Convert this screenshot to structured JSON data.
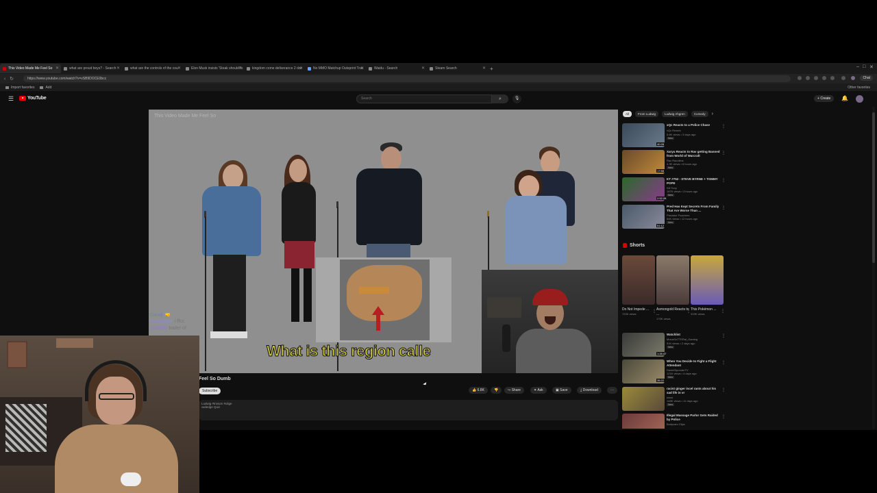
{
  "browser": {
    "tabs": [
      {
        "label": "This Video Made Me Feel So",
        "active": true,
        "favicon": "youtube"
      },
      {
        "label": "what are proud boys? - Search",
        "active": false,
        "favicon": "bing"
      },
      {
        "label": "what are the controls of the cou",
        "active": false,
        "favicon": "bing"
      },
      {
        "label": "Elon Musk insists 'Steak should fo",
        "active": false,
        "favicon": "news"
      },
      {
        "label": "kingdom come deliverance 2 dwr",
        "active": false,
        "favicon": "bing"
      },
      {
        "label": "No MMO Matchup Outsprint Trac",
        "active": false,
        "favicon": "github"
      },
      {
        "label": "Waidu - Search",
        "active": false,
        "favicon": "bing"
      },
      {
        "label": "Steam Search",
        "active": false,
        "favicon": "steam"
      }
    ],
    "new_tab": "+",
    "window_controls": [
      "–",
      "□",
      "✕"
    ],
    "url": "https://www.youtube.com/watch?v=vSB9DOCE0bcc",
    "chat_button": "Chat",
    "bookmarks": [
      "Import favorites",
      "Add"
    ],
    "other_favorites": "Other favorites"
  },
  "youtube": {
    "logo_text": "YouTube",
    "search_placeholder": "Search",
    "create_label": "Create"
  },
  "player": {
    "overlay_title": "This Video Made Me Feel So",
    "caption": "What is this region calle",
    "chat": [
      {
        "user": "Gandj",
        "msg": "🤜"
      },
      {
        "user": "wheburger",
        "msg": "i ffcc"
      },
      {
        "user": "cyton88",
        "msg": "trailer of"
      }
    ]
  },
  "video": {
    "title": "Feel So Dumb",
    "subscribe": "Subscribe",
    "actions": {
      "likes": "6.8K",
      "share": "Share",
      "ask": "Ask",
      "save": "Save",
      "download": "Download",
      "more": "···"
    },
    "description_line1": "Ludwig #trivium #ulige",
    "description_line2": "owledge Quiz"
  },
  "sidebar": {
    "chips": [
      "All",
      "From Ludwig",
      "Ludwig Ahgren",
      "Comedy"
    ],
    "recommendations": [
      {
        "title": "xQc Reacts to a Police Chase",
        "channel": "xQc Reacts",
        "meta": "5.6K views • 3 days ago",
        "badge": "New",
        "duration": "40:28"
      },
      {
        "title": "Xaryu Reacts to Rav getting Banned from World of Warcraft",
        "channel": "Rav Racolitos",
        "meta": "4.3K views • 6 hours ago",
        "badge": "New",
        "duration": "17:58"
      },
      {
        "title": "KT #752 - STEVE BYRNE + TOMMY POPE",
        "channel": "Kill Tony",
        "meta": "187K views • 3 hours ago",
        "badge": "New",
        "duration": "2:52:26"
      },
      {
        "title": "Pred Has Kept Secrets From Family That Are Worse Than ...",
        "channel": "Predator Poachers",
        "meta": "54K views • 12 hours ago",
        "badge": "New",
        "duration": "51:12"
      },
      {
        "title": "Watchlist",
        "channel": "MonoGoTTERal_Gaming",
        "meta": "51K views • 2 days ago",
        "badge": "New",
        "duration": "1:26:47"
      },
      {
        "title": "When You Decide to Fight a Flight Attendant",
        "channel": "DanielSponderTV",
        "meta": "121K views • 4 days ago",
        "badge": "New",
        "duration": "35:22"
      },
      {
        "title": "racist ginger incel rants about his sad life in vr",
        "channel": "wwst",
        "meta": "148K views • 11 days ago",
        "badge": "New",
        "duration": ""
      },
      {
        "title": "Illegal Massage Parlor Gets Raided by Police",
        "channel": "Bodycam Clips",
        "meta": "",
        "badge": "",
        "duration": ""
      }
    ],
    "shorts_title": "Shorts",
    "shorts": [
      {
        "label": "Do Not Impede ...",
        "views": "720K views"
      },
      {
        "label": "Asmongold Reacts to ...",
        "views": "170K views"
      },
      {
        "label": "This Pokémon ...",
        "views": "319K views"
      }
    ]
  },
  "colors": {
    "youtube_red": "#ff0000",
    "caption_yellow": "#c9c23f",
    "background": "#0f0f0f"
  }
}
